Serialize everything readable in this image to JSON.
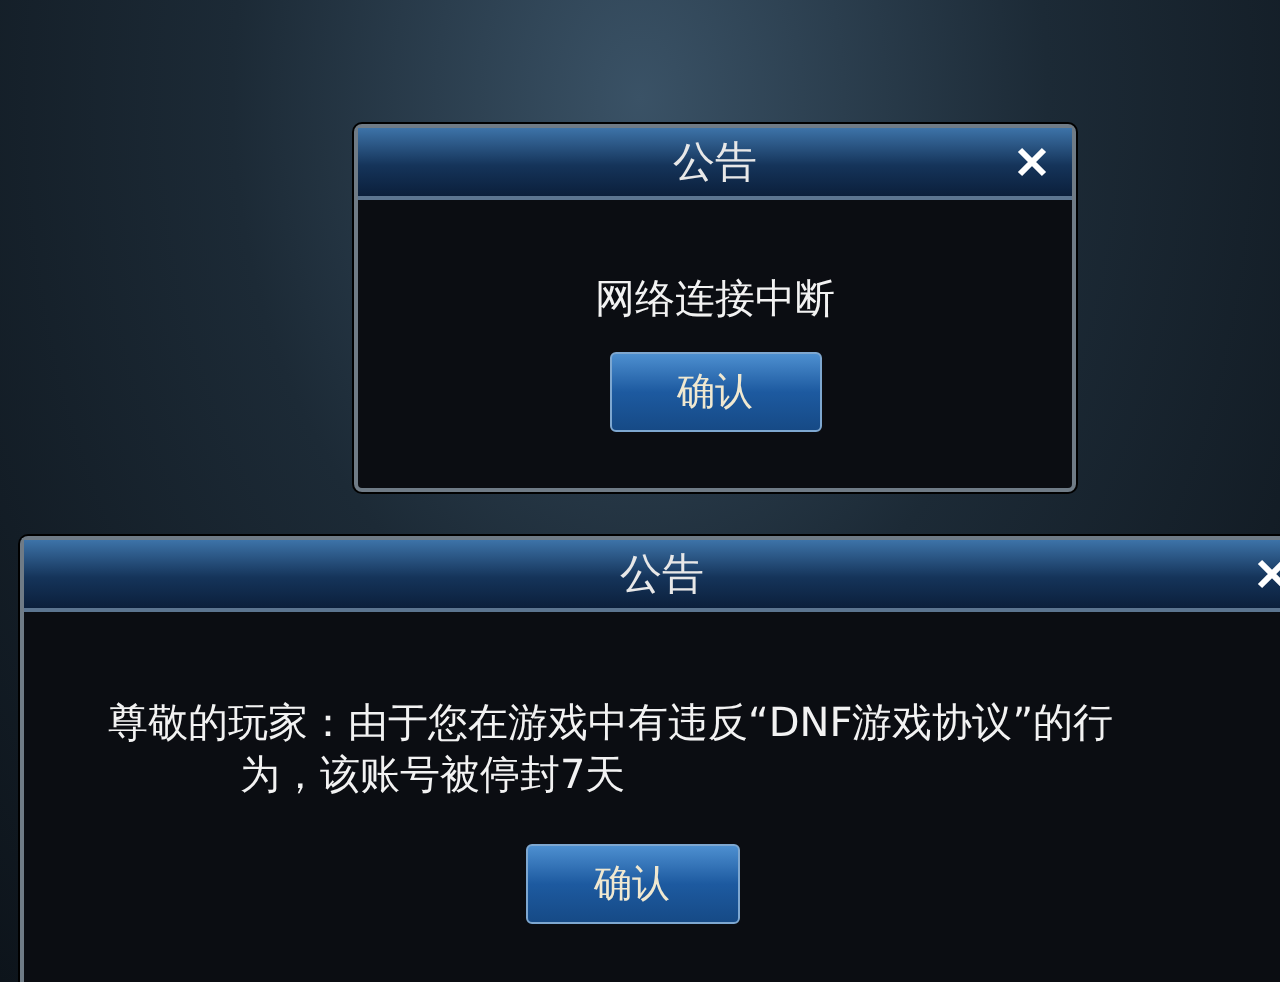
{
  "dialogs": [
    {
      "title": "公告",
      "message": "网络连接中断",
      "button": "确认"
    },
    {
      "title": "公告",
      "message": "尊敬的玩家：由于您在游戏中有违反“DNF游戏协议”的行为，该账号被停封7天",
      "button": "确认"
    }
  ]
}
